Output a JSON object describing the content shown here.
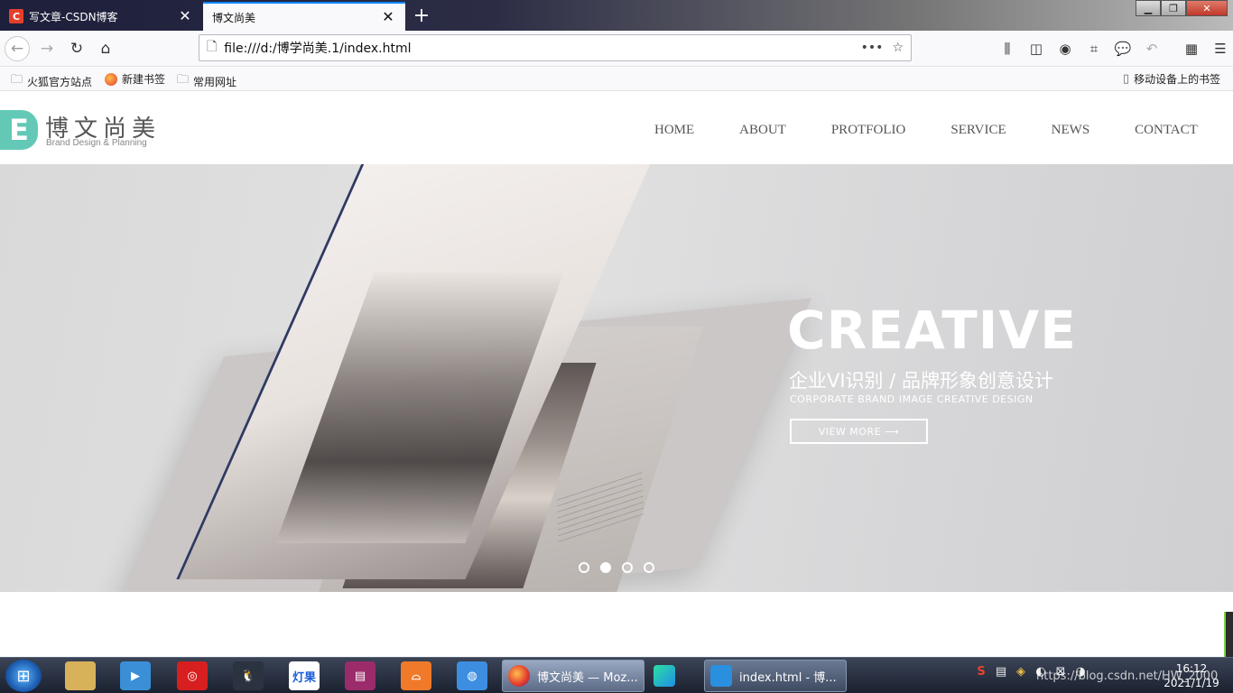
{
  "browser": {
    "tabs": [
      {
        "favicon": "C",
        "title": "写文章-CSDN博客",
        "close": "✕"
      },
      {
        "title": "博文尚美",
        "close": "✕"
      }
    ],
    "new_tab": "+",
    "window_controls": {
      "minimize": "▁",
      "maximize": "❐",
      "close": "✕"
    },
    "nav": {
      "back": "←",
      "forward": "→",
      "reload": "↻",
      "home": "⌂"
    },
    "url": "file:///d:/博学尚美.1/index.html",
    "url_icons": {
      "page": "🗋",
      "more": "•••",
      "star": "☆"
    },
    "toolbar_icons": {
      "library": "⫼",
      "sidebar": "◫",
      "account": "◉",
      "screenshot": "⌗",
      "chat": "💬",
      "undo": "↶",
      "extensions": "▦",
      "menu": "☰"
    },
    "bookmarks": [
      {
        "label": "火狐官方站点",
        "icon": "folder-icon"
      },
      {
        "label": "新建书签",
        "icon": "firefox-icon"
      },
      {
        "label": "常用网址",
        "icon": "folder-icon"
      }
    ],
    "mobile_bookmarks": "移动设备上的书签"
  },
  "site": {
    "logo": {
      "mark": "E",
      "cn": "博文尚美",
      "en": "Brand Design & Planning"
    },
    "nav": [
      "HOME",
      "ABOUT",
      "PROTFOLIO",
      "SERVICE",
      "NEWS",
      "CONTACT"
    ],
    "hero": {
      "title": "CREATIVE",
      "subtitle_cn": "企业VI识别 / 品牌形象创意设计",
      "subtitle_en": "CORPORATE BRAND IMAGE CREATIVE DESIGN",
      "button": "VIEW MORE ⟶",
      "dots_count": 4,
      "active_dot": 1
    }
  },
  "taskbar": {
    "pins": [
      {
        "label": "",
        "color": "#d8b25a"
      },
      {
        "label": "▶",
        "color": "#3a8fd6"
      },
      {
        "label": "◎",
        "color": "#d71f1f"
      },
      {
        "label": "🐧",
        "color": "#2b3240"
      },
      {
        "label": "灯果",
        "color": "#ffffff"
      },
      {
        "label": "▤",
        "color": "#9b2b6a"
      },
      {
        "label": "⌓",
        "color": "#f07a2a"
      },
      {
        "label": "◍",
        "color": "#3d8de0"
      }
    ],
    "windows": [
      {
        "title": "博文尚美 — Moz...",
        "icon_color": "#f26b1d",
        "active": true
      },
      {
        "title": "",
        "icon_color": "#1fb6e8",
        "active": false
      },
      {
        "title": "index.html - 博...",
        "icon_color": "#2b8fe0",
        "active": false
      }
    ],
    "tray": [
      "S",
      "▤",
      "◈",
      "◐",
      "⊠",
      "◑"
    ],
    "watermark": "https://blog.csdn.net/HW_2000",
    "time": "16:12",
    "date": "2021/1/19"
  }
}
